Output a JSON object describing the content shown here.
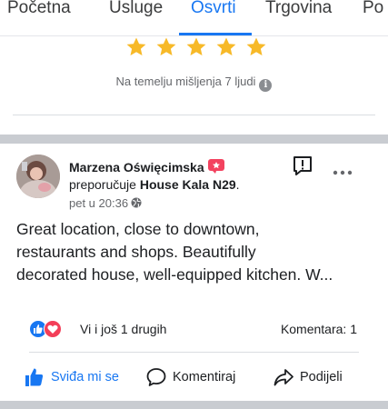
{
  "tabs": [
    {
      "label": "Početna"
    },
    {
      "label": "Usluge"
    },
    {
      "label": "Osvrti"
    },
    {
      "label": "Trgovina"
    },
    {
      "label": "Po"
    }
  ],
  "active_tab": "Osvrti",
  "rating": {
    "stars": 5,
    "note": "Na temelju mišljenja 7 ljudi",
    "star_color": "#f7b928"
  },
  "post": {
    "author": "Marzena Oświęcimska",
    "recommends_prefix": "preporučuje",
    "page_name": "House Kala N29",
    "period": ".",
    "time": "pet u 20:36",
    "text_lines": [
      "Great location, close to downtown,",
      "restaurants and shops.  Beautifully",
      "decorated house, well-equipped kitchen.  W..."
    ],
    "reactions_text": "Vi i još 1 drugih",
    "comments_count": "Komentara: 1",
    "actions": {
      "like": "Sviđa mi se",
      "comment": "Komentiraj",
      "share": "Podijeli"
    }
  },
  "colors": {
    "accent": "#1877f2",
    "recommend_badge": "#f3425f",
    "love": "#f33e58"
  }
}
